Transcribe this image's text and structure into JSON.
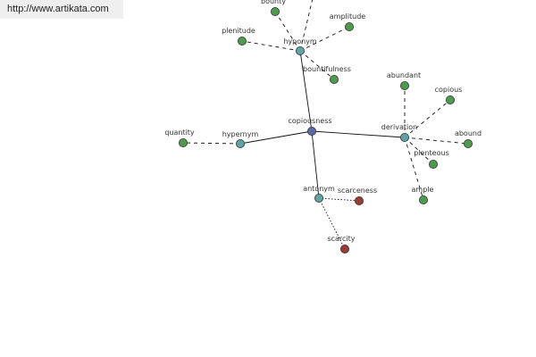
{
  "source_url": "http://www.artikata.com",
  "colors": {
    "center": "#5a6aa8",
    "relation": "#5fa3a3",
    "word": "#4f9a4f",
    "antonym_word": "#9a3a35",
    "edge": "#111111"
  },
  "graph": {
    "center": {
      "id": "copiousness",
      "label": "copiousness"
    },
    "relations": [
      {
        "id": "hyponym",
        "label": "hyponym",
        "words": [
          "bounty",
          "amplitude",
          "plenitude",
          "bountifulness",
          ""
        ]
      },
      {
        "id": "derivation",
        "label": "derivation",
        "words": [
          "abundant",
          "copious",
          "abound",
          "plenteous",
          "ample"
        ]
      },
      {
        "id": "hypernym",
        "label": "hypernym",
        "words": [
          "quantity"
        ]
      },
      {
        "id": "antonym",
        "label": "antonym",
        "words": [
          "scarceness",
          "scarcity"
        ]
      }
    ]
  }
}
